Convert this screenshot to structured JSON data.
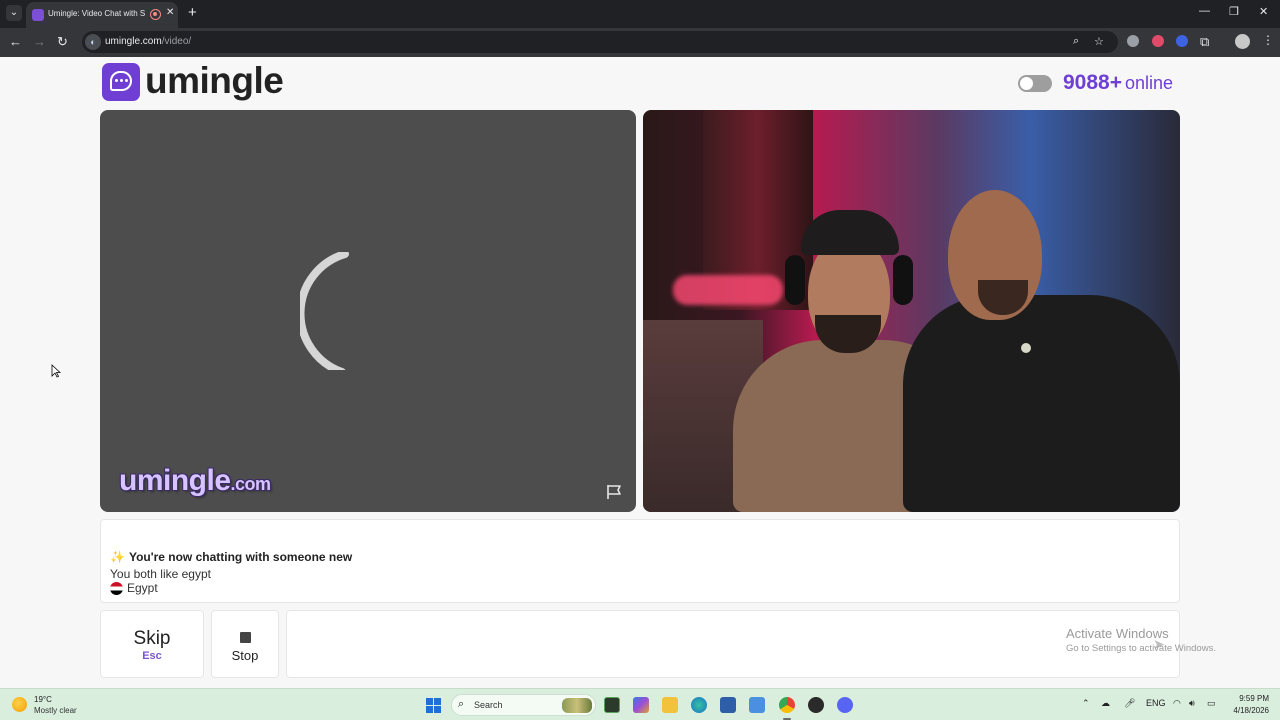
{
  "browser": {
    "tab_title": "Umingle: Video Chat with S",
    "url_host": "umingle.com",
    "url_path": "/video/",
    "icons": [
      "tab-list-icon",
      "favicon",
      "recording-icon",
      "close-tab-icon",
      "new-tab-icon",
      "minimize-icon",
      "maximize-icon",
      "close-window-icon",
      "back-icon",
      "forward-icon",
      "reload-icon",
      "site-info-icon",
      "zoom-icon",
      "bookmark-star-icon",
      "extensions-icon",
      "profile-avatar",
      "menu-icon"
    ]
  },
  "site": {
    "logo_text": "umingle",
    "online_count": "9088+",
    "online_label": "online",
    "toggle_on": false,
    "brand_color": "#6f3fd4"
  },
  "video": {
    "left_state": "loading",
    "watermark_name": "umingle",
    "watermark_tld": ".com"
  },
  "chat": {
    "new_chat_text": "You're now chatting with someone new",
    "common_interest": "You both like egypt",
    "country": "Egypt"
  },
  "controls": {
    "skip_label": "Skip",
    "skip_key": "Esc",
    "stop_label": "Stop"
  },
  "os_overlay": {
    "activate_title": "Activate Windows",
    "activate_hint": "Go to Settings to activate Windows."
  },
  "taskbar": {
    "weather_temp": "19°C",
    "weather_desc": "Mostly clear",
    "search_label": "Search",
    "lang": "ENG",
    "time": "9:59 PM",
    "date": "4/18/2026"
  }
}
